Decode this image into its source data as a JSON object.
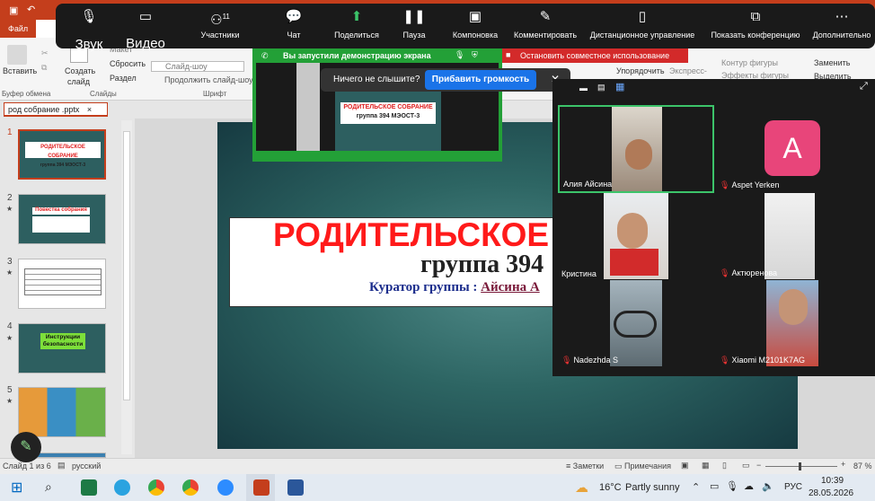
{
  "ppt": {
    "file_tab": "Файл",
    "ribbon": {
      "paste": "Вставить",
      "create_slide": "Создать",
      "create_slide2": "слайд",
      "maket": "Макет",
      "reset": "Сбросить",
      "section": "Раздел",
      "font_box": "Слайд-шоу",
      "font_box2": "Продолжить слайд-шоу",
      "clipboard_group": "Буфер обмена",
      "slides_group": "Слайды",
      "font_group": "Шрифт",
      "arrange": "Упорядочить",
      "express": "Экспресс-",
      "shape_outline": "Контур фигуры",
      "shape_effects": "Эффекты фигуры",
      "replace": "Заменить",
      "select": "Выделить"
    },
    "doc_tab": "род собрание .pptx",
    "thumbs": [
      {
        "num": "1"
      },
      {
        "num": "2",
        "title": "Повестка собрания"
      },
      {
        "num": "3"
      },
      {
        "num": "4",
        "title": "Инструкции безопасности"
      },
      {
        "num": "5"
      }
    ],
    "thumb1_title": "РОДИТЕЛЬСКОЕ СОБРАНИЕ",
    "thumb1_sub": "группа 394 МЭОСТ-3",
    "slide": {
      "title": "РОДИТЕЛЬСКОЕ",
      "group": "группа 394",
      "curator_label": "Куратор группы : ",
      "curator_name": "Айсина А"
    },
    "status": {
      "slide_info": "Слайд 1 из 6",
      "language": "русский",
      "notes": "Заметки",
      "comments": "Примечания",
      "zoom": "87 %"
    }
  },
  "zoom": {
    "toolbar": [
      {
        "label": "Звук",
        "icon": "mic-muted-icon"
      },
      {
        "label": "Видео",
        "icon": "video-off-icon"
      },
      {
        "label": "Участники",
        "icon": "participants-icon",
        "badge": "11"
      },
      {
        "label": "Чат",
        "icon": "chat-icon"
      },
      {
        "label": "Поделиться",
        "icon": "share-icon"
      },
      {
        "label": "Пауза",
        "icon": "pause-icon"
      },
      {
        "label": "Компоновка",
        "icon": "layout-icon"
      },
      {
        "label": "Комментировать",
        "icon": "pen-icon"
      },
      {
        "label": "Дистанционное управление",
        "icon": "mouse-icon"
      },
      {
        "label": "Показать конференцию",
        "icon": "conference-icon"
      },
      {
        "label": "Дополнительно",
        "icon": "more-icon"
      }
    ],
    "share_banner": "Вы запустили демонстрацию экрана",
    "stop_share": "Остановить совместное использование",
    "audio_tip": "Ничего не слышите?",
    "audio_button": "Прибавить громкость",
    "participants": [
      {
        "name": "Алия Айсина",
        "muted": false
      },
      {
        "name": "Aspet Yerken",
        "muted": true,
        "initial": "A"
      },
      {
        "name": "Кристина",
        "muted": false
      },
      {
        "name": "Актюренова",
        "muted": true
      },
      {
        "name": "Nadezhda S",
        "muted": true
      },
      {
        "name": "Xiaomi M2101K7AG",
        "muted": true
      }
    ],
    "colors": {
      "active_speaker": "#3cc46a",
      "share_green": "#23a037",
      "stop_red": "#d32a2a",
      "avatar_pink": "#e8457a"
    }
  },
  "taskbar": {
    "weather_temp": "16°C",
    "weather_desc": "Partly sunny",
    "lang": "РУС",
    "time": "10:39",
    "date": "28.05.2026"
  }
}
